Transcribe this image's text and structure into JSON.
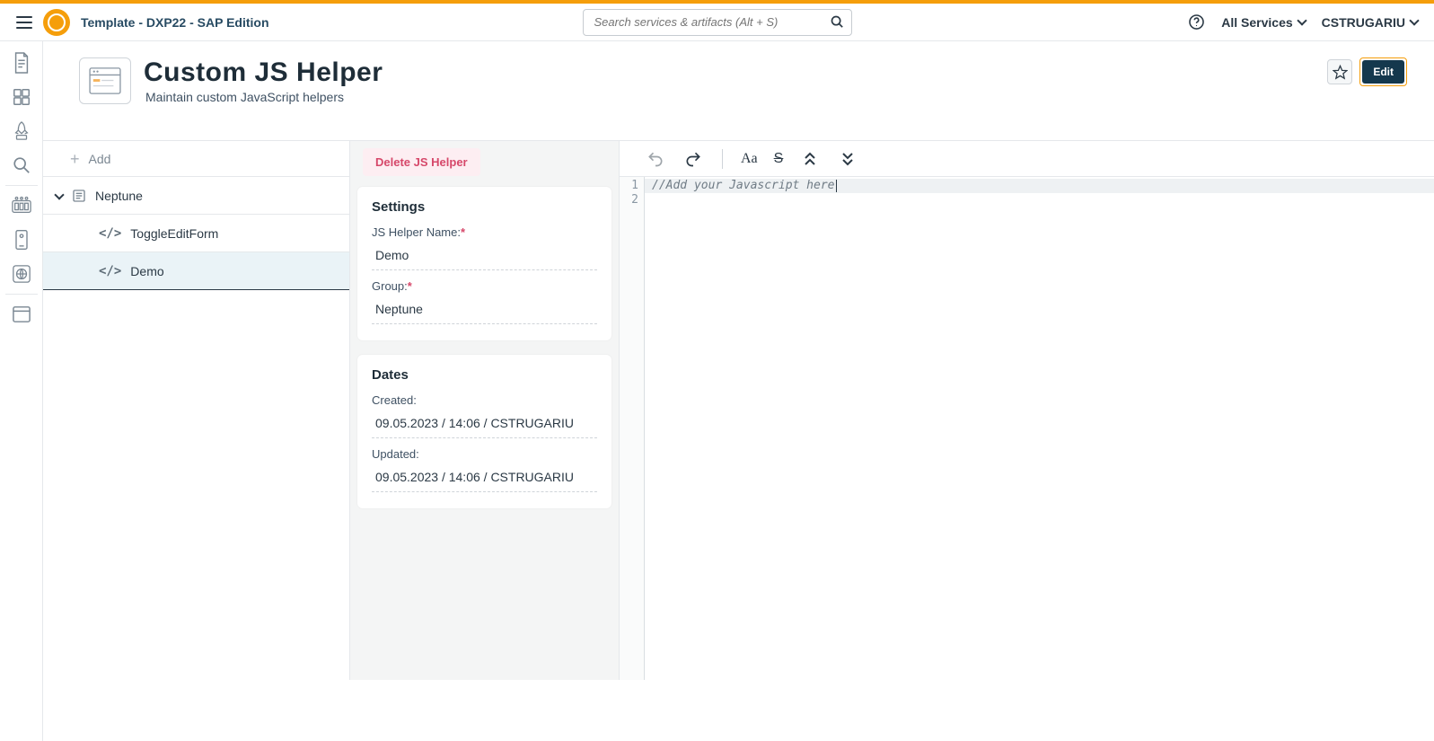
{
  "header": {
    "template_label": "Template  - DXP22 - SAP Edition",
    "search_placeholder": "Search services & artifacts (Alt + S)",
    "all_services_label": "All Services",
    "username": "CSTRUGARIU"
  },
  "page": {
    "title": "Custom JS Helper",
    "subtitle": "Maintain custom JavaScript helpers",
    "edit_label": "Edit"
  },
  "tree": {
    "add_label": "Add",
    "group_label": "Neptune",
    "items": [
      {
        "label": "ToggleEditForm"
      },
      {
        "label": "Demo"
      }
    ]
  },
  "details": {
    "delete_label": "Delete JS Helper",
    "settings_heading": "Settings",
    "name_label": "JS Helper Name:",
    "name_value": "Demo",
    "group_label": "Group:",
    "group_value": "Neptune",
    "dates_heading": "Dates",
    "created_label": "Created:",
    "created_value": "09.05.2023 / 14:06 / CSTRUGARIU",
    "updated_label": "Updated:",
    "updated_value": "09.05.2023 / 14:06 / CSTRUGARIU"
  },
  "editor": {
    "lines": [
      "//Add your Javascript here",
      ""
    ]
  }
}
